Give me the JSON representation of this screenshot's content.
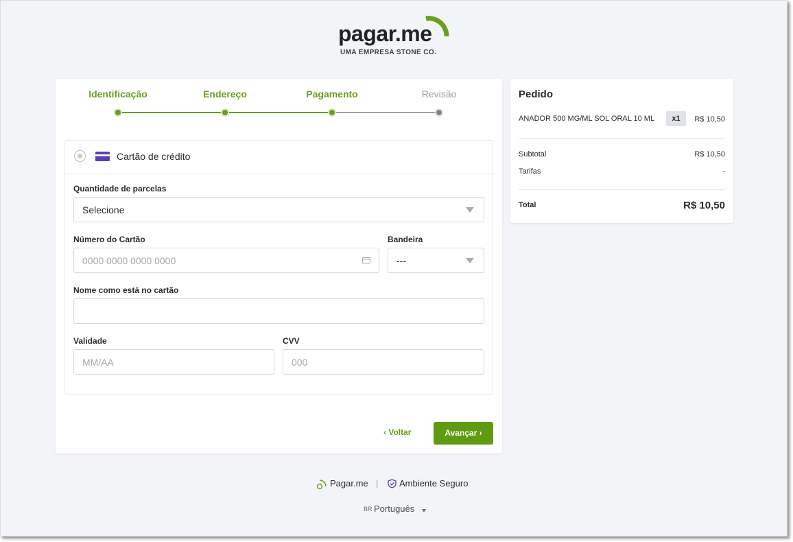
{
  "brand": {
    "name": "pagar.me",
    "tagline": "UMA EMPRESA STONE CO.",
    "accent_color": "#6a9e1f"
  },
  "steps": [
    {
      "label": "Identificação",
      "state": "done"
    },
    {
      "label": "Endereço",
      "state": "done"
    },
    {
      "label": "Pagamento",
      "state": "current"
    },
    {
      "label": "Revisão",
      "state": "pending"
    }
  ],
  "payment": {
    "method_label": "Cartão de crédito",
    "method_icon": "credit-card-icon",
    "installments": {
      "label": "Quantidade de parcelas",
      "value": "Selecione"
    },
    "card_number": {
      "label": "Número do Cartão",
      "placeholder": "0000 0000 0000 0000"
    },
    "brand_select": {
      "label": "Bandeira",
      "value": "---"
    },
    "card_name": {
      "label": "Nome como está no cartão",
      "placeholder": ""
    },
    "expiry": {
      "label": "Validade",
      "placeholder": "MM/AA"
    },
    "cvv": {
      "label": "CVV",
      "placeholder": "000"
    }
  },
  "actions": {
    "back_label": "Voltar",
    "next_label": "Avançar"
  },
  "order": {
    "title": "Pedido",
    "item": {
      "name": "ANADOR 500 MG/ML SOL ORAL 10 ML",
      "qty": "x1",
      "price": "R$ 10,50"
    },
    "subtotal_label": "Subtotal",
    "subtotal_value": "R$ 10,50",
    "fees_label": "Tarifas",
    "fees_value": "-",
    "total_label": "Total",
    "total_value": "R$ 10,50"
  },
  "footer": {
    "brand_link": "Pagar.me",
    "separator": "|",
    "secure_label": "Ambiente Seguro",
    "lang_code": "BR",
    "language": "Português"
  }
}
